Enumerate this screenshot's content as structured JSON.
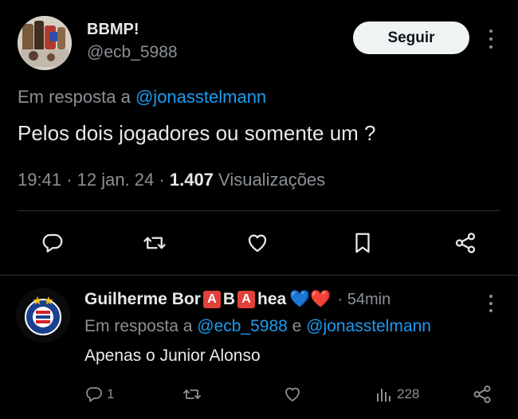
{
  "tweet": {
    "author_name": "BBMP!",
    "author_handle": "@ecb_5988",
    "follow_label": "Seguir",
    "reply_prefix": "Em resposta a",
    "reply_mention": "@jonasstelmann",
    "text": "Pelos dois jogadores ou somente um ?",
    "time": "19:41",
    "date": "12 jan. 24",
    "views_count": "1.407",
    "views_label": "Visualizações",
    "actions": [
      "reply-icon",
      "retweet-icon",
      "like-icon",
      "bookmark-icon",
      "share-icon"
    ]
  },
  "reply": {
    "name_part1": "Guilherme Bor",
    "emoji_letter_1": "A",
    "name_part2": "B",
    "emoji_letter_2": "A",
    "name_part3": "hea",
    "hearts": "💙❤️",
    "time": "· 54min",
    "reply_prefix": "Em resposta a",
    "mention_1": "@ecb_5988",
    "conjunction": "e",
    "mention_2": "@jonasstelmann",
    "text": "Apenas o Junior Alonso",
    "reply_count": "1",
    "views_count": "228"
  },
  "colors": {
    "background": "#000000",
    "text_primary": "#e7e9ea",
    "text_secondary": "#8b9095",
    "link": "#1d9bf0",
    "divider": "#2f3336",
    "follow_bg": "#eff3f4"
  }
}
